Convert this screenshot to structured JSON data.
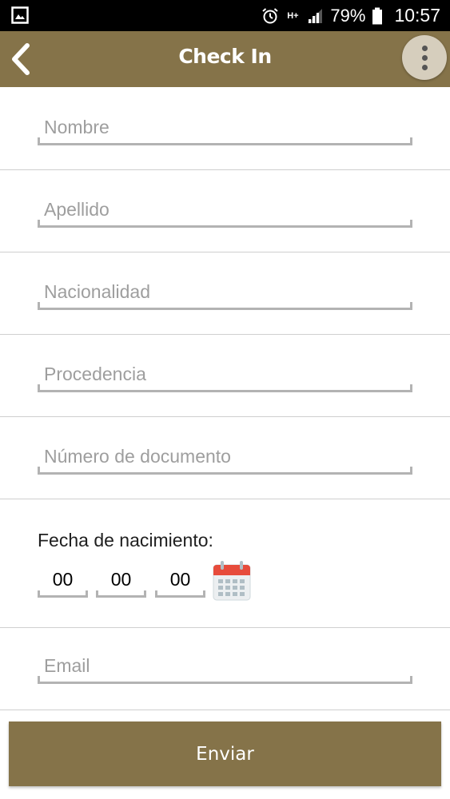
{
  "status_bar": {
    "network": "H+",
    "battery": "79%",
    "time": "10:57",
    "icons": [
      "image-icon",
      "alarm-icon",
      "signal-icon",
      "battery-icon"
    ]
  },
  "app_bar": {
    "title": "Check In",
    "background": "#857349",
    "icons": [
      "back-arrow-icon",
      "more-vert-icon"
    ]
  },
  "form": {
    "fields": [
      {
        "placeholder": "Nombre",
        "value": ""
      },
      {
        "placeholder": "Apellido",
        "value": ""
      },
      {
        "placeholder": "Nacionalidad",
        "value": ""
      },
      {
        "placeholder": "Procedencia",
        "value": ""
      },
      {
        "placeholder": "Número de documento",
        "value": ""
      }
    ],
    "birth_date": {
      "label": "Fecha de nacimiento:",
      "day": "00",
      "month": "00",
      "year": "00",
      "icon": "calendar-icon"
    },
    "email": {
      "placeholder": "Email",
      "value": ""
    },
    "submit_label": "Enviar"
  },
  "colors": {
    "accent": "#857349",
    "menu_button": "#d6cebd",
    "underline": "#b3b3b3",
    "divider": "#cfcfcf",
    "calendar_red": "#e74c3c"
  }
}
